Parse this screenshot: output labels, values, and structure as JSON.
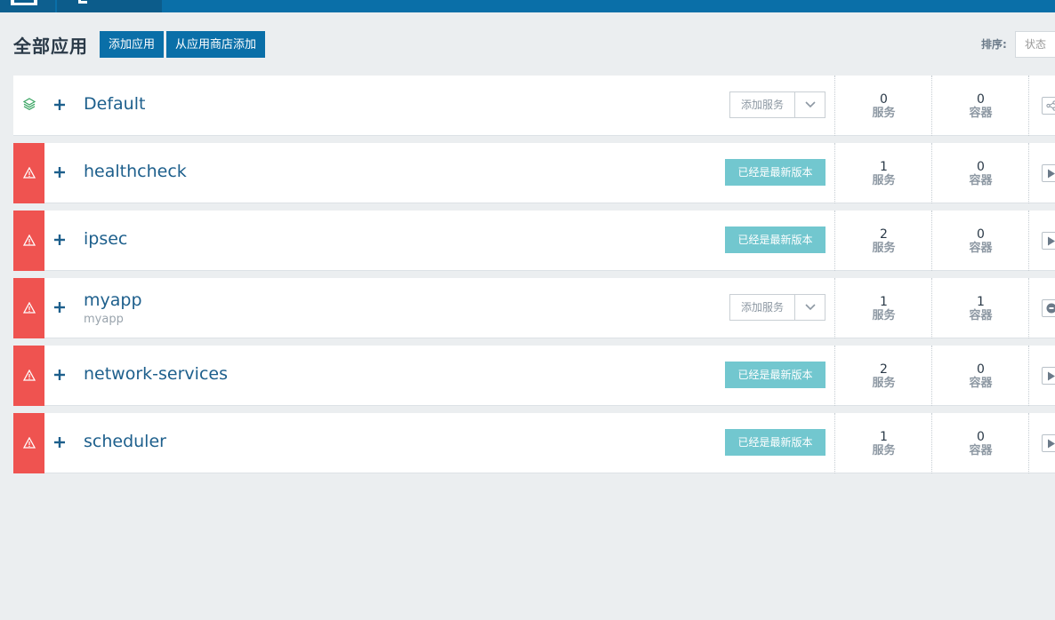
{
  "page": {
    "title": "全部应用",
    "add_stack_label": "添加应用",
    "add_from_catalog_label": "从应用商店添加",
    "sort_label": "排序:",
    "sort_value": "状态"
  },
  "colors": {
    "primary": "#0a6fa8",
    "error": "#ef5350",
    "upgrade_badge": "#72c7cf",
    "link": "#1d5f8c"
  },
  "stacks": [
    {
      "name": "Default",
      "sub": "",
      "state": "active",
      "state_icon": "layers-icon",
      "action": "add_service",
      "services": "0",
      "containers": "0",
      "action_icon": "share-icon"
    },
    {
      "name": "healthcheck",
      "sub": "",
      "state": "error",
      "state_icon": "warning-icon",
      "action": "upgrade",
      "services": "1",
      "containers": "0",
      "action_icon": "play-icon"
    },
    {
      "name": "ipsec",
      "sub": "",
      "state": "error",
      "state_icon": "warning-icon",
      "action": "upgrade",
      "services": "2",
      "containers": "0",
      "action_icon": "play-icon"
    },
    {
      "name": "myapp",
      "sub": "myapp",
      "state": "error",
      "state_icon": "warning-icon",
      "action": "add_service",
      "services": "1",
      "containers": "1",
      "action_icon": "stop-icon"
    },
    {
      "name": "network-services",
      "sub": "",
      "state": "error",
      "state_icon": "warning-icon",
      "action": "upgrade",
      "services": "2",
      "containers": "0",
      "action_icon": "play-icon"
    },
    {
      "name": "scheduler",
      "sub": "",
      "state": "error",
      "state_icon": "warning-icon",
      "action": "upgrade",
      "services": "1",
      "containers": "0",
      "action_icon": "play-icon"
    }
  ],
  "labels": {
    "add_service": "添加服务",
    "upgrade": "已经是最新版本",
    "services": "服务",
    "containers": "容器"
  }
}
